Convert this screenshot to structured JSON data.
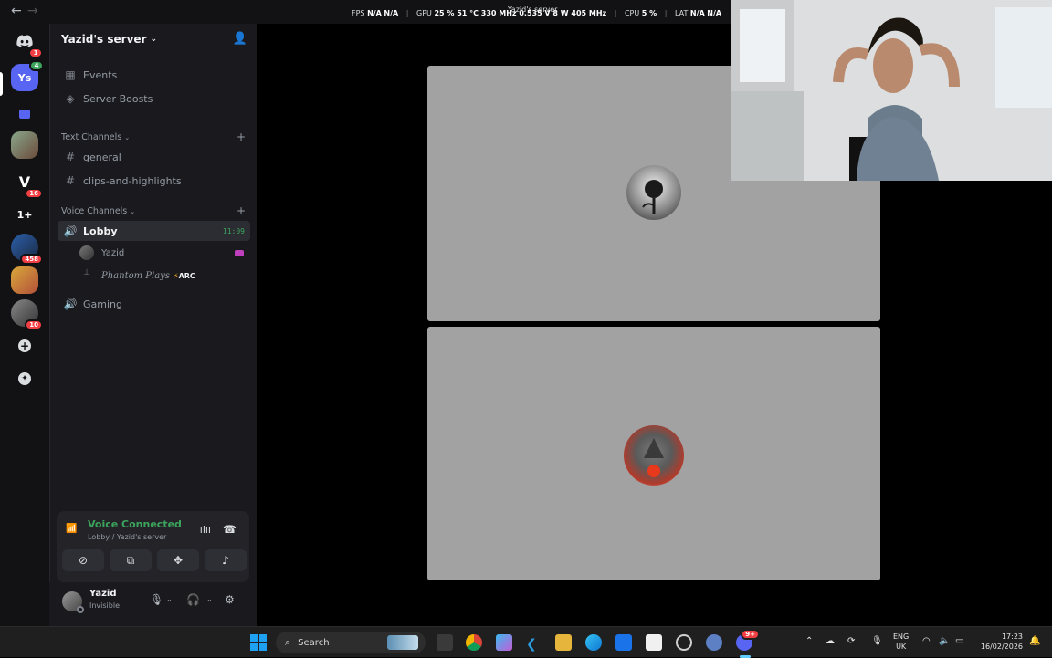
{
  "overlay": {
    "fps_label": "FPS",
    "fps_value": "N/A",
    "fps_value2": "N/A",
    "gpu_label": "GPU",
    "gpu_value": "25 % 51 °C 330 MHz 0.535 V 8 W 405 MHz",
    "cpu_label": "CPU",
    "cpu_value": "5 %",
    "lat_label": "LAT",
    "lat_value": "N/A",
    "lat_value2": "N/A",
    "window_title": "Yazid's server"
  },
  "rail": {
    "dm_badge": "1",
    "server_ys_label": "Ys",
    "server_ys_badge": "4",
    "badge_16": "16",
    "label_1plus": "1+",
    "badge_458": "458",
    "badge_10": "10"
  },
  "sidebar": {
    "server_name": "Yazid's server",
    "events_label": "Events",
    "boosts_label": "Server Boosts",
    "text_category": "Text Channels",
    "text_channels": [
      "general",
      "clips-and-highlights"
    ],
    "voice_category": "Voice Channels",
    "voice_channels": [
      {
        "name": "Lobby",
        "timer": "11:09"
      },
      {
        "name": "Gaming"
      }
    ],
    "voice_users": [
      {
        "name": "Yazid"
      },
      {
        "name": "Phantom Plays",
        "tag": "ARC"
      }
    ]
  },
  "voice_panel": {
    "title": "Voice Connected",
    "subtitle": "Lobby / Yazid's server"
  },
  "user": {
    "name": "Yazid",
    "status": "Invisible"
  },
  "taskbar": {
    "search_placeholder": "Search",
    "lang_top": "ENG",
    "lang_bottom": "UK",
    "time": "17:23",
    "date": "16/02/2026",
    "discord_badge": "9+"
  },
  "colors": {
    "voice_green": "#3ba55d",
    "badge_red": "#f23f43",
    "tile_gray": "#a2a2a2",
    "ys_server": "#5865f2"
  }
}
